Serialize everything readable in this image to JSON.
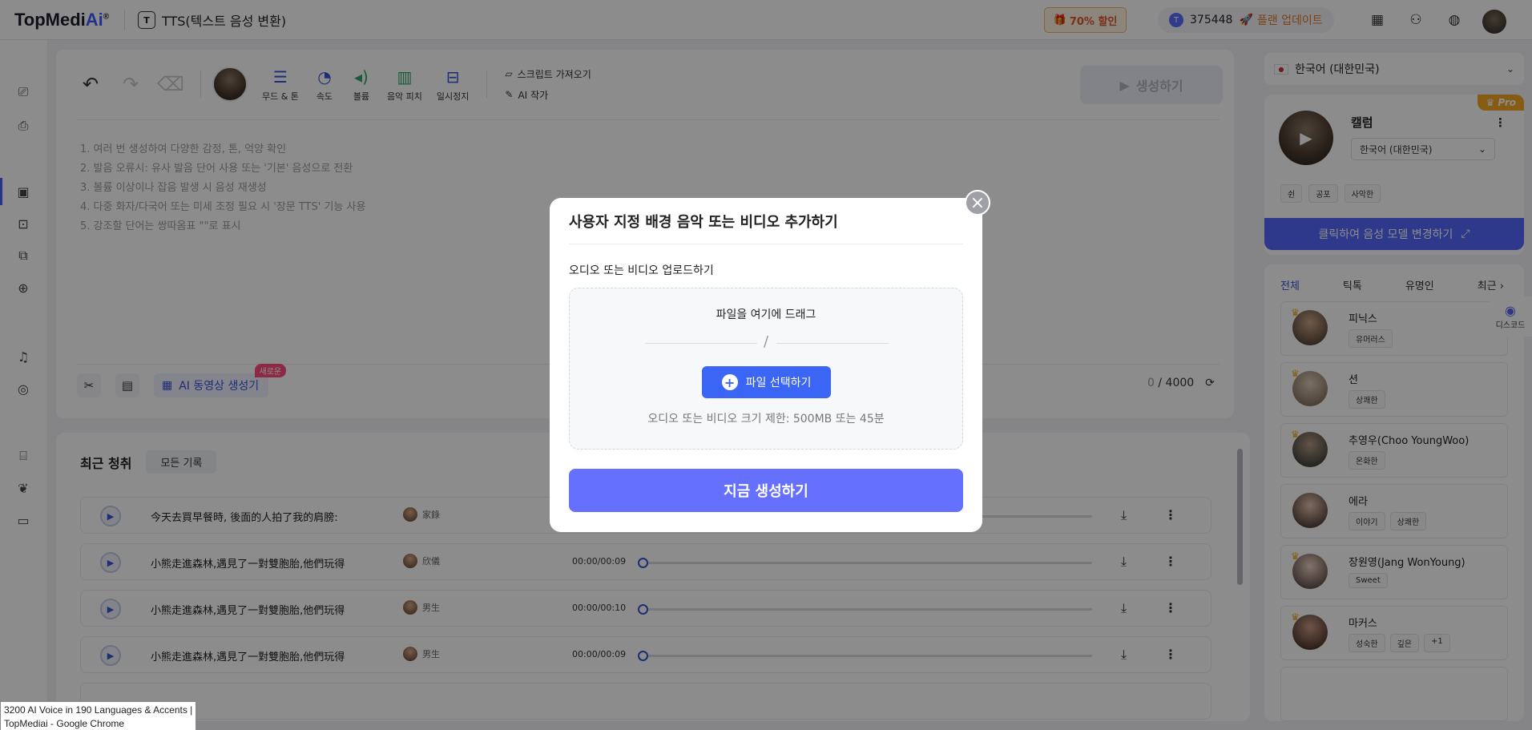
{
  "header": {
    "logo_main": "TopMedi",
    "logo_ai": "Ai",
    "logo_mark": "®",
    "app_title": "TTS(텍스트 음성 변환)",
    "promo": "70% 할인",
    "credits": "375448",
    "upgrade": "플랜 업데이트"
  },
  "toolbar": {
    "mood_tone": "무드 & 톤",
    "speed": "속도",
    "volume": "볼륨",
    "pitch": "음악 피치",
    "pause": "일시정지",
    "script_import": "스크립트 가져오기",
    "ai_writer": "AI 작가",
    "generate": "생성하기"
  },
  "editor": {
    "hints": [
      "1. 여러 번 생성하여 다양한 감정, 톤, 억양 확인",
      "2. 발음 오류시: 유사 발음 단어 사용 또는 '기본' 음성으로 전환",
      "3. 볼륨 이상이나 잡음 발생 시 음성 재생성",
      "4. 다중 화자/다국어 또는 미세 조정 필요 시 '장문 TTS' 기능 사용",
      "5. 강조할 단어는 쌍따옴표 \"\"로 표시"
    ],
    "ai_video": "AI 동영상 생성기",
    "new_badge": "새로운",
    "count_current": "0",
    "count_max": "/ 4000"
  },
  "recent": {
    "title": "최근 청취",
    "all_records": "모든 기록",
    "rows": [
      {
        "text": "今天去買早餐時, 後面的人拍了我的肩膀:",
        "speaker": "家錄",
        "time": ""
      },
      {
        "text": "小熊走進森林,遇見了一對雙胞胎,他們玩得",
        "speaker": "欣儀",
        "time": "00:00/00:09"
      },
      {
        "text": "小熊走進森林,遇見了一對雙胞胎,他們玩得",
        "speaker": "男生",
        "time": "00:00/00:10"
      },
      {
        "text": "小熊走進森林,遇見了一對雙胞胎,他們玩得",
        "speaker": "男生",
        "time": "00:00/00:09"
      }
    ]
  },
  "right_panel": {
    "language": "한국어 (대한민국)",
    "pro": "Pro",
    "voice_name": "캘럼",
    "voice_lang": "한국어 (대한민국)",
    "voice_tags": [
      "쉰",
      "공포",
      "사악한"
    ],
    "change_model": "클릭하여 음성 모델 변경하기",
    "tabs": [
      "전체",
      "틱톡",
      "유명인",
      "최근"
    ],
    "voices": [
      {
        "name": "피닉스",
        "tags": [
          "유머러스"
        ],
        "crown": true
      },
      {
        "name": "션",
        "tags": [
          "상쾌한"
        ],
        "crown": true
      },
      {
        "name": "추영우(Choo YoungWoo)",
        "tags": [
          "온화한"
        ],
        "crown": true
      },
      {
        "name": "에라",
        "tags": [
          "이야기",
          "상쾌한"
        ],
        "crown": false
      },
      {
        "name": "장원영(Jang WonYoung)",
        "tags": [
          "Sweet"
        ],
        "crown": true
      },
      {
        "name": "마커스",
        "tags": [
          "성숙한",
          "깊은",
          "+1"
        ],
        "crown": true
      }
    ],
    "discord": "디스코드"
  },
  "modal": {
    "title": "사용자 지정 배경 음악 또는 비디오 추가하기",
    "upload_label": "오디오 또는 비디오 업로드하기",
    "drag_text": "파일을 여기에 드래그",
    "separator": "/",
    "select_file": "파일 선택하기",
    "size_limit": "오디오 또는 비디오 크기 제한: 500MB 또는 45분",
    "generate_now": "지금 생성하기"
  },
  "tooltip": {
    "line1": "3200 AI Voice in 190 Languages & Accents |",
    "line2": "TopMediai - Google Chrome"
  }
}
